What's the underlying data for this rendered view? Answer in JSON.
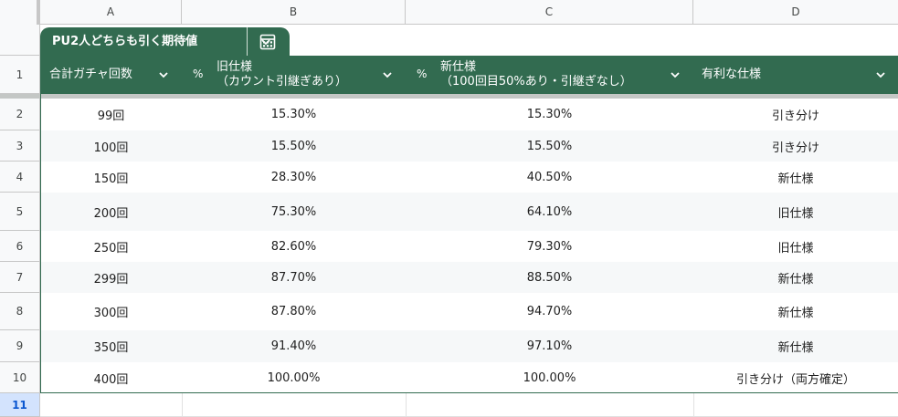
{
  "columns": [
    "A",
    "B",
    "C",
    "D"
  ],
  "table_tab": {
    "name": "PU2人どちらも引く期待値",
    "chevron_icon": "chevron-down-icon",
    "view_icon": "calculator-icon"
  },
  "headers": [
    {
      "prefix": "",
      "line1": "合計ガチャ回数",
      "line2": ""
    },
    {
      "prefix": "%",
      "line1": "旧仕様",
      "line2": "（カウント引継ぎあり）"
    },
    {
      "prefix": "%",
      "line1": "新仕様",
      "line2": "（100回目50%あり・引継ぎなし）"
    },
    {
      "prefix": "",
      "line1": "有利な仕様",
      "line2": ""
    }
  ],
  "row_numbers": [
    "1",
    "2",
    "3",
    "4",
    "5",
    "6",
    "7",
    "8",
    "9",
    "10",
    "11"
  ],
  "selected_row": "11",
  "rows": [
    {
      "a": "99回",
      "b": "15.30%",
      "c": "15.30%",
      "d": "引き分け"
    },
    {
      "a": "100回",
      "b": "15.50%",
      "c": "15.50%",
      "d": "引き分け"
    },
    {
      "a": "150回",
      "b": "28.30%",
      "c": "40.50%",
      "d": "新仕様"
    },
    {
      "a": "200回",
      "b": "75.30%",
      "c": "64.10%",
      "d": "旧仕様"
    },
    {
      "a": "250回",
      "b": "82.60%",
      "c": "79.30%",
      "d": "旧仕様"
    },
    {
      "a": "299回",
      "b": "87.70%",
      "c": "88.50%",
      "d": "新仕様"
    },
    {
      "a": "300回",
      "b": "87.80%",
      "c": "94.70%",
      "d": "新仕様"
    },
    {
      "a": "350回",
      "b": "91.40%",
      "c": "97.10%",
      "d": "新仕様"
    },
    {
      "a": "400回",
      "b": "100.00%",
      "c": "100.00%",
      "d": "引き分け（両方確定）"
    }
  ],
  "colors": {
    "table_header": "#326b50",
    "band": "#f6f8f9",
    "selected_row_bg": "#d3e3fd",
    "selected_row_fg": "#0b57d0"
  }
}
